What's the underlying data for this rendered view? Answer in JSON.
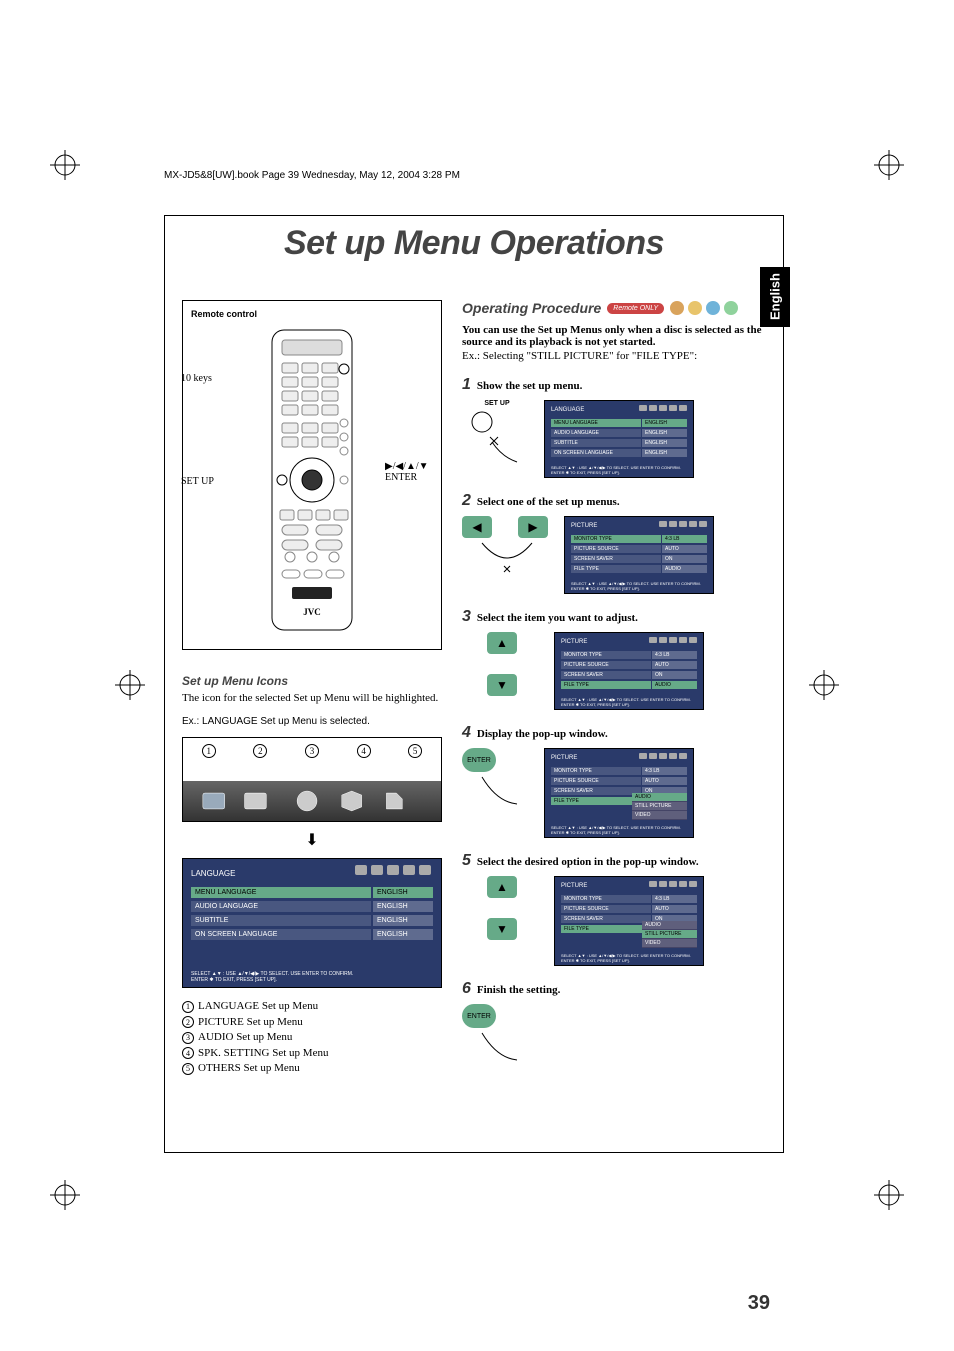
{
  "header_line": "MX-JD5&8[UW].book  Page 39  Wednesday, May 12, 2004  3:28 PM",
  "page_title": "Set up Menu Operations",
  "lang_tab": "English",
  "remote": {
    "box_label": "Remote control",
    "ten_keys": "10 keys",
    "setup": "SET UP",
    "enter": "ENTER",
    "nav": "▶/◀/▲/▼",
    "brand": "JVC"
  },
  "icons_section": {
    "heading": "Set up Menu Icons",
    "desc": "The icon for the selected Set up Menu will be highlighted.",
    "example": "Ex.: LANGUAGE Set up Menu is selected.",
    "nums": [
      "1",
      "2",
      "3",
      "4",
      "5"
    ]
  },
  "lang_menu": {
    "title": "LANGUAGE",
    "rows": [
      {
        "label": "MENU LANGUAGE",
        "value": "ENGLISH",
        "hi": true
      },
      {
        "label": "AUDIO LANGUAGE",
        "value": "ENGLISH"
      },
      {
        "label": "SUBTITLE",
        "value": "ENGLISH"
      },
      {
        "label": "ON SCREEN LANGUAGE",
        "value": "ENGLISH"
      }
    ],
    "footer1": "SELECT ▲▼   : USE ▲/▼/◀/▶ TO SELECT. USE ENTER TO CONFIRM.",
    "footer2": "ENTER ✱    TO EXIT, PRESS [SET UP]."
  },
  "icon_list": [
    {
      "n": "1",
      "t": "LANGUAGE Set up Menu"
    },
    {
      "n": "2",
      "t": "PICTURE Set up Menu"
    },
    {
      "n": "3",
      "t": "AUDIO Set up Menu"
    },
    {
      "n": "4",
      "t": "SPK. SETTING Set up Menu"
    },
    {
      "n": "5",
      "t": "OTHERS Set up Menu"
    }
  ],
  "op": {
    "heading": "Operating Procedure",
    "remote_only": "Remote ONLY",
    "intro_bold": "You can use the Set up Menus only when a disc is selected as the source and its playback is not yet started.",
    "intro_ex": "Ex.: Selecting \"STILL PICTURE\" for \"FILE TYPE\":",
    "footer1": "SELECT ▲▼ : USE ▲/▼/◀/▶ TO SELECT. USE ENTER TO CONFIRM.",
    "footer2": "ENTER ✱   TO EXIT, PRESS [SET UP]."
  },
  "steps": [
    {
      "n": "1",
      "t": "Show the set up menu.",
      "setup_label": "SET UP",
      "menu": {
        "title": "LANGUAGE",
        "rows": [
          {
            "l": "MENU LANGUAGE",
            "v": "ENGLISH",
            "hi": true
          },
          {
            "l": "AUDIO LANGUAGE",
            "v": "ENGLISH"
          },
          {
            "l": "SUBTITLE",
            "v": "ENGLISH"
          },
          {
            "l": "ON SCREEN LANGUAGE",
            "v": "ENGLISH"
          }
        ]
      }
    },
    {
      "n": "2",
      "t": "Select one of the set up menus.",
      "menu": {
        "title": "PICTURE",
        "rows": [
          {
            "l": "MONITOR TYPE",
            "v": "4:3 LB",
            "hi": true
          },
          {
            "l": "PICTURE SOURCE",
            "v": "AUTO"
          },
          {
            "l": "SCREEN SAVER",
            "v": "ON"
          },
          {
            "l": "FILE TYPE",
            "v": "AUDIO"
          }
        ]
      }
    },
    {
      "n": "3",
      "t": "Select the item you want to adjust.",
      "menu": {
        "title": "PICTURE",
        "rows": [
          {
            "l": "MONITOR TYPE",
            "v": "4:3 LB"
          },
          {
            "l": "PICTURE SOURCE",
            "v": "AUTO"
          },
          {
            "l": "SCREEN SAVER",
            "v": "ON"
          },
          {
            "l": "FILE TYPE",
            "v": "AUDIO",
            "hi": true
          }
        ]
      }
    },
    {
      "n": "4",
      "t": "Display the pop-up window.",
      "menu": {
        "title": "PICTURE",
        "rows": [
          {
            "l": "MONITOR TYPE",
            "v": "4:3 LB"
          },
          {
            "l": "PICTURE SOURCE",
            "v": "AUTO"
          },
          {
            "l": "SCREEN SAVER",
            "v": "ON"
          },
          {
            "l": "FILE TYPE",
            "v": "AUDIO",
            "hi": true
          }
        ],
        "popup": [
          {
            "t": "AUDIO",
            "hi": true
          },
          {
            "t": "STILL PICTURE"
          },
          {
            "t": "VIDEO"
          }
        ]
      }
    },
    {
      "n": "5",
      "t": "Select the desired option in the pop-up window.",
      "menu": {
        "title": "PICTURE",
        "rows": [
          {
            "l": "MONITOR TYPE",
            "v": "4:3 LB"
          },
          {
            "l": "PICTURE SOURCE",
            "v": "AUTO"
          },
          {
            "l": "SCREEN SAVER",
            "v": "ON"
          },
          {
            "l": "FILE TYPE",
            "v": "AUDIO",
            "hi": true
          }
        ],
        "popup": [
          {
            "t": "AUDIO"
          },
          {
            "t": "STILL PICTURE",
            "hi": true
          },
          {
            "t": "VIDEO"
          }
        ]
      }
    },
    {
      "n": "6",
      "t": "Finish the setting."
    }
  ],
  "page_number": "39"
}
